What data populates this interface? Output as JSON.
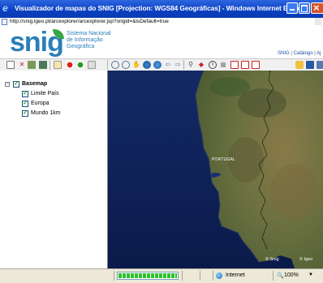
{
  "window": {
    "title": "Visualizador de mapas do SNIG [Projection: WGS84 Geográficas] - Windows Internet Explorer"
  },
  "address": {
    "url": "http://snig.igeo.pt/arcexplorer/arcexplorer.jsp?origid=&isDefault=true"
  },
  "header": {
    "logo": "snig",
    "logo_lines": [
      "Sistema Nacional",
      "de Informação",
      "Geográfica"
    ],
    "links": [
      "SNIG",
      "Catálogo",
      "Aj"
    ]
  },
  "layers": {
    "root": {
      "label": "Basemap",
      "checked": true,
      "expanded": true
    },
    "items": [
      {
        "label": "Limite País",
        "checked": true
      },
      {
        "label": "Europa",
        "checked": true
      },
      {
        "label": "Mundo 1km",
        "checked": true
      }
    ]
  },
  "map": {
    "country_label": "PORTUGAL",
    "credits": [
      "© Snig",
      "© Igeo"
    ]
  },
  "status": {
    "progress": 1.0,
    "zone": "Internet",
    "zoom": "100%"
  },
  "colors": {
    "accent": "#2a7fb8",
    "titlebar": "#0a3fc2",
    "progress": "#2cc12c"
  }
}
